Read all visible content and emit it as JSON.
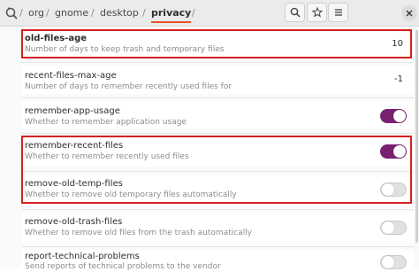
{
  "header": {
    "path": [
      "org",
      "gnome",
      "desktop",
      "privacy"
    ],
    "separator": "/",
    "icons": {
      "root": "dconf-root-icon",
      "search": "search-icon",
      "bookmark": "star-icon",
      "menu": "hamburger-menu-icon",
      "close": "close-icon"
    }
  },
  "settings": [
    {
      "key": "old-files-age",
      "description": "Number of days to keep trash and temporary files",
      "value": "10",
      "type": "number",
      "edited": true
    },
    {
      "key": "recent-files-max-age",
      "description": "Number of days to remember recently used files for",
      "value": "-1",
      "type": "number"
    },
    {
      "key": "remember-app-usage",
      "description": "Whether to remember application usage",
      "state": true,
      "type": "toggle"
    },
    {
      "key": "remember-recent-files",
      "description": "Whether to remember recently used files",
      "state": true,
      "type": "toggle"
    },
    {
      "key": "remove-old-temp-files",
      "description": "Whether to remove old temporary files automatically",
      "state": false,
      "type": "toggle"
    },
    {
      "key": "remove-old-trash-files",
      "description": "Whether to remove old files from the trash automatically",
      "state": false,
      "type": "toggle"
    },
    {
      "key": "report-technical-problems",
      "description": "Send reports of technical problems to the vendor",
      "state": false,
      "type": "toggle"
    }
  ],
  "colors": {
    "accent": "#e95420",
    "toggle_on": "#77216f",
    "highlight": "#d42020"
  }
}
